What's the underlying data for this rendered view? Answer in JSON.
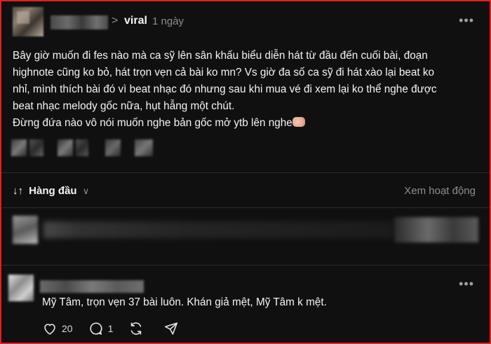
{
  "post": {
    "topic": "viral",
    "chevron": ">",
    "time": "1 ngày",
    "body_lines": [
      "Bây giờ muốn đi fes nào mà ca sỹ lên sân khấu biểu diễn hát từ đầu đến cuối bài, đoạn",
      "highnote cũng ko bỏ, hát trọn vẹn cả bài ko mn? Vs giờ đa số ca sỹ đi hát xào lại beat ko",
      "nhỉ, mình thích bài đó vì beat nhạc đó nhưng sau khi mua vé đi xem lại ko thể nghe được",
      "beat nhạc melody gốc nữa, hụt hẫng một chút.",
      "Đừng đứa nào vô nói muốn nghe bản gốc mở ytb lên nghe"
    ],
    "more_icon": "more-horizontal-icon"
  },
  "sort": {
    "arrows": "↓↑",
    "label": "Hàng đầu",
    "caret": "∨",
    "activity_link": "Xem hoạt động"
  },
  "comment": {
    "text": "Mỹ Tâm, trọn vẹn 37 bài luôn. Khán giả mệt, Mỹ Tâm k mệt.",
    "likes": "20",
    "replies": "1"
  },
  "colors": {
    "background": "#101010",
    "border": "#e0201c",
    "text": "#f3f5f7",
    "muted": "#8e8e8e"
  }
}
